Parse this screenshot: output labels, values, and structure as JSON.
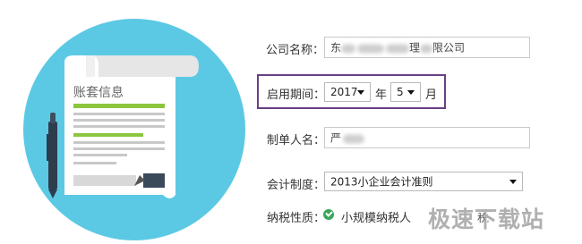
{
  "illustration": {
    "document_title": "账套信息",
    "circle_color": "#5cc9e4"
  },
  "form": {
    "company_name": {
      "label": "公司名称：",
      "value_prefix": "东",
      "value_suffix": "理",
      "value_end": "限公司"
    },
    "start_period": {
      "label": "启用期间：",
      "year": "2017",
      "year_unit": "年",
      "month": "5",
      "month_unit": "月"
    },
    "preparer": {
      "label": "制单人名：",
      "value_prefix": "严"
    },
    "accounting_system": {
      "label": "会计制度：",
      "value": "2013小企业会计准则"
    },
    "taxpayer_type": {
      "label": "纳税性质：",
      "option_selected": "小规模纳税人",
      "option_other_suffix": "税"
    }
  },
  "watermark": "极速下载站",
  "colors": {
    "highlight_border": "#6a3f86",
    "check_green": "#3aa55a"
  }
}
